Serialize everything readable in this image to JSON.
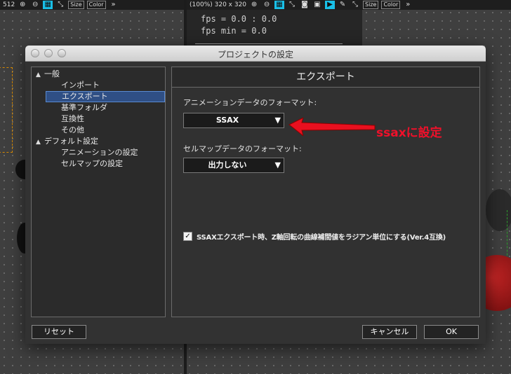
{
  "background_app": {
    "left_toolbar": {
      "zoom_text": "512",
      "size_tag": "Size",
      "color_tag": "Color"
    },
    "right_toolbar": {
      "zoom_text": "(100%) 320 x 320",
      "size_tag": "Size",
      "color_tag": "Color"
    },
    "stats": {
      "fps_line": "fps = 0.0 : 0.0",
      "fps_min_line": "fps min = 0.0"
    }
  },
  "dialog": {
    "title": "プロジェクトの設定",
    "tree": [
      {
        "label": "一般",
        "type": "category"
      },
      {
        "label": "インポート",
        "type": "child"
      },
      {
        "label": "エクスポート",
        "type": "child",
        "selected": true
      },
      {
        "label": "基準フォルダ",
        "type": "child"
      },
      {
        "label": "互換性",
        "type": "child"
      },
      {
        "label": "その他",
        "type": "child"
      },
      {
        "label": "デフォルト設定",
        "type": "category"
      },
      {
        "label": "アニメーションの設定",
        "type": "child"
      },
      {
        "label": "セルマップの設定",
        "type": "child"
      }
    ],
    "panel": {
      "header": "エクスポート",
      "anim_format_label": "アニメーションデータのフォーマット:",
      "anim_format_value": "SSAX",
      "cellmap_format_label": "セルマップデータのフォーマット:",
      "cellmap_format_value": "出力しない",
      "z_rotation_checkbox_label": "SSAXエクスポート時、Z軸回転の曲線補間値をラジアン単位にする(Ver.4互換)",
      "z_rotation_checked": true
    },
    "buttons": {
      "reset": "リセット",
      "cancel": "キャンセル",
      "ok": "OK"
    }
  },
  "annotation": {
    "text": "ssaxに設定",
    "color": "#f0102a"
  },
  "colors": {
    "selection": "#2f4f85",
    "toolbar_active": "#19c0e8"
  }
}
